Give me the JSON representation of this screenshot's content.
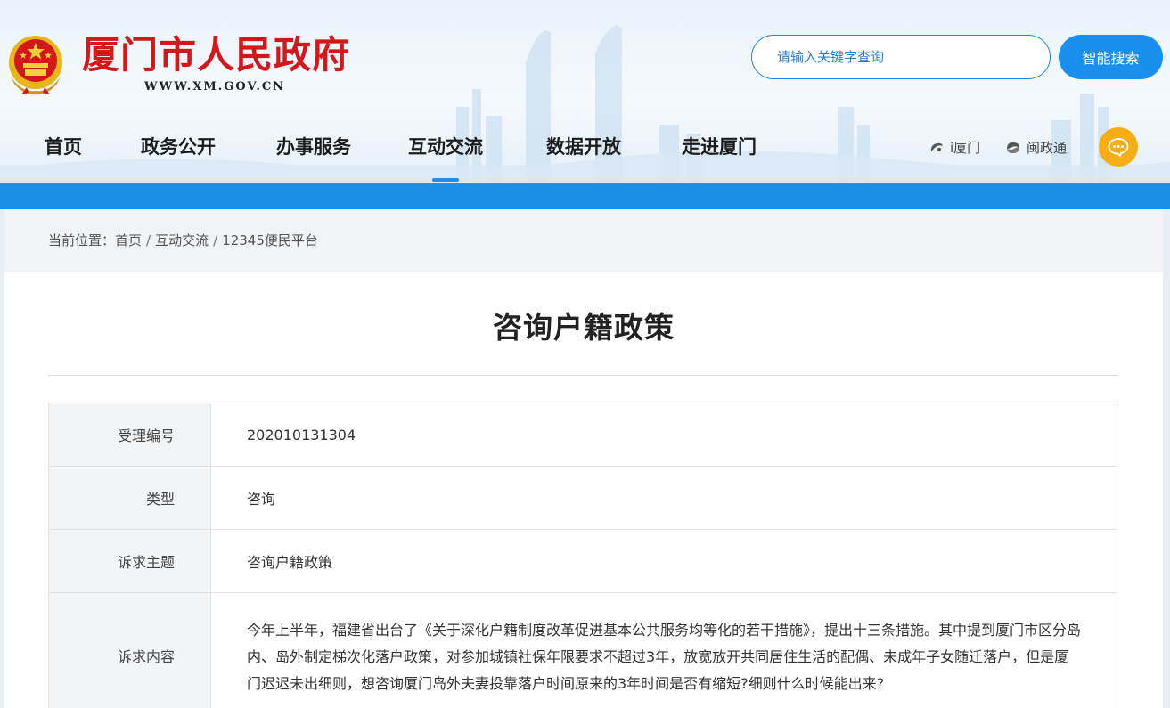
{
  "header": {
    "site_title": "厦门市人民政府",
    "site_url": "WWW.XM.GOV.CN",
    "search_placeholder": "请输入关键字查询",
    "search_button": "智能搜索",
    "brand_color": "#d4171a",
    "accent_color": "#1b8ff0"
  },
  "nav": {
    "items": [
      {
        "label": "首页"
      },
      {
        "label": "政务公开"
      },
      {
        "label": "办事服务"
      },
      {
        "label": "互动交流",
        "active": true
      },
      {
        "label": "数据开放"
      },
      {
        "label": "走进厦门"
      }
    ],
    "quick_links": [
      {
        "label": "i厦门",
        "icon": "ixiamen-icon"
      },
      {
        "label": "闽政通",
        "icon": "minzhengtong-icon"
      }
    ],
    "chat_icon": "chat-bubble-icon"
  },
  "breadcrumb": {
    "prefix": "当前位置：",
    "items": [
      "首页",
      "互动交流",
      "12345便民平台"
    ],
    "separator": "/"
  },
  "article": {
    "title": "咨询户籍政策",
    "fields": [
      {
        "label": "受理编号",
        "value": "202010131304"
      },
      {
        "label": "类型",
        "value": "咨询"
      },
      {
        "label": "诉求主题",
        "value": "咨询户籍政策"
      },
      {
        "label": "诉求内容",
        "value": "今年上半年，福建省出台了《关于深化户籍制度改革促进基本公共服务均等化的若干措施》，提出十三条措施。其中提到厦门市区分岛内、岛外制定梯次化落户政策，对参加城镇社保年限要求不超过3年，放宽放开共同居住生活的配偶、未成年子女随迁落户，但是厦门迟迟未出细则，想咨询厦门岛外夫妻投靠落户时间原来的3年时间是否有缩短?细则什么时候能出来?"
      }
    ]
  }
}
